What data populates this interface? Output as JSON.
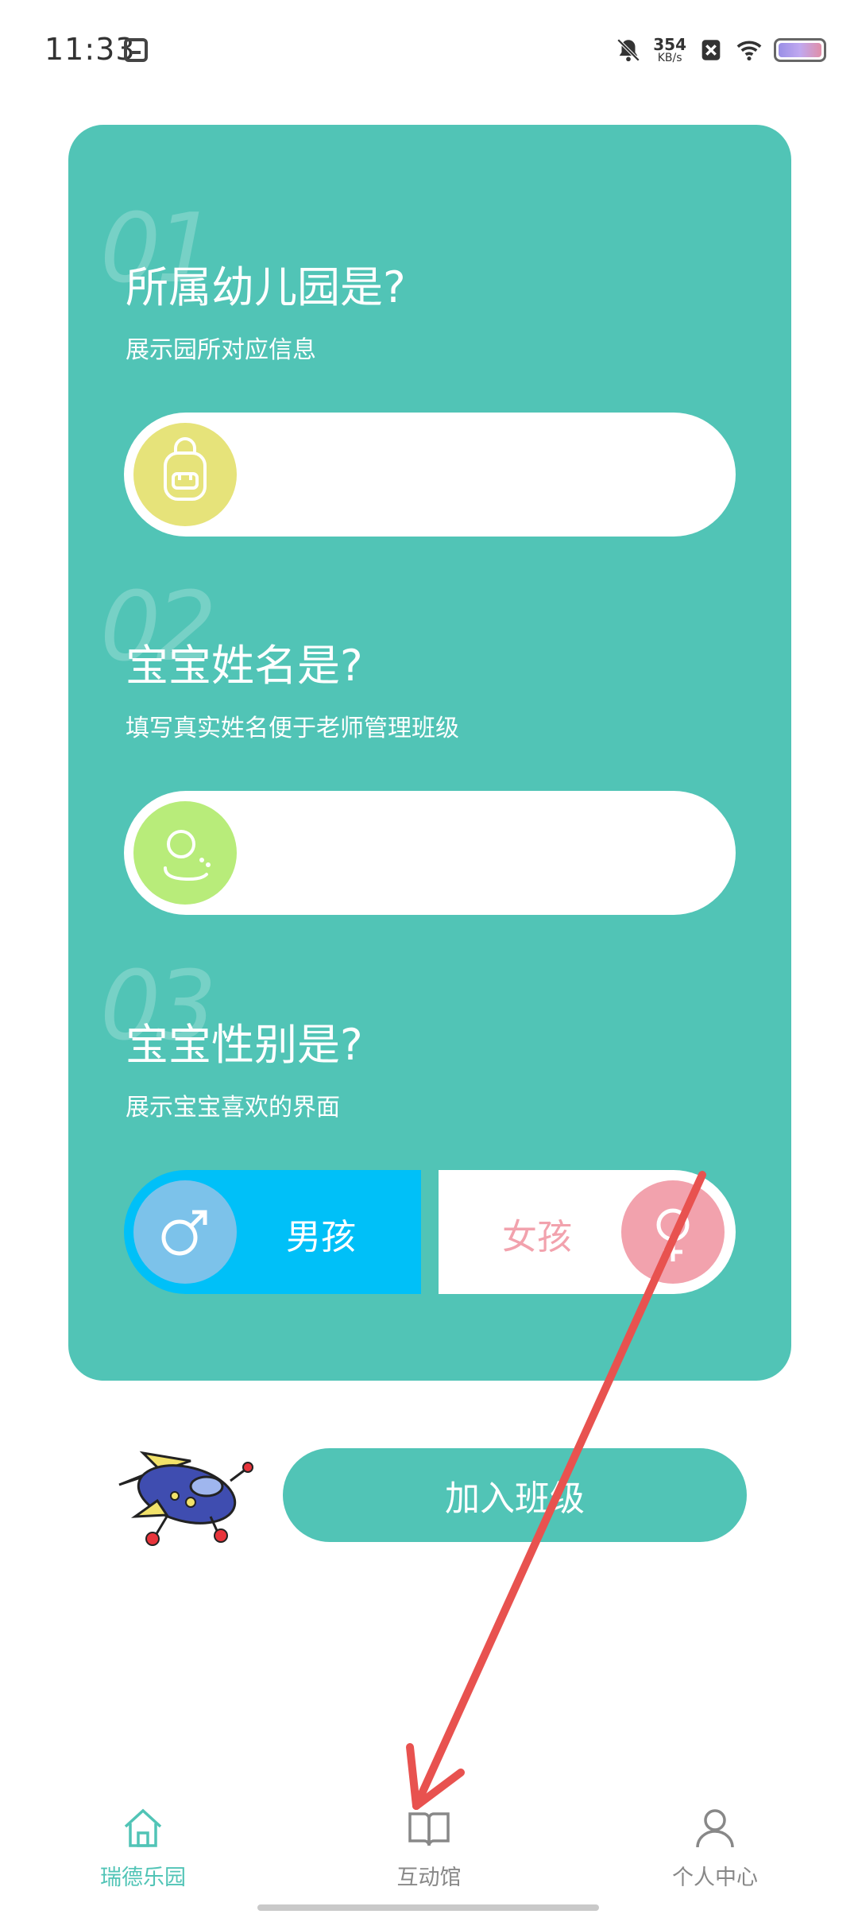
{
  "status_bar": {
    "time": "11:33",
    "speed_value": "354",
    "speed_unit": "KB/s"
  },
  "sections": [
    {
      "number": "01",
      "title": "所属幼儿园是?",
      "subtitle": "展示园所对应信息",
      "icon": "backpack-icon",
      "icon_color": "#e6e37a"
    },
    {
      "number": "02",
      "title": "宝宝姓名是?",
      "subtitle": "填写真实姓名便于老师管理班级",
      "icon": "baby-face-icon",
      "icon_color": "#b8ec7a"
    },
    {
      "number": "03",
      "title": "宝宝性别是?",
      "subtitle": "展示宝宝喜欢的界面"
    }
  ],
  "gender": {
    "boy_label": "男孩",
    "girl_label": "女孩",
    "boy_color": "#00c0f8",
    "boy_circle_color": "#7cc2ea",
    "girl_color": "#f2a2ad",
    "selected": "男孩"
  },
  "join_button_label": "加入班级",
  "nav": {
    "items": [
      {
        "label": "瑞德乐园",
        "icon": "home-icon",
        "active": true
      },
      {
        "label": "互动馆",
        "icon": "book-icon",
        "active": false
      },
      {
        "label": "个人中心",
        "icon": "person-icon",
        "active": false
      }
    ],
    "active_color": "#51c4b6",
    "inactive_color": "#888888"
  },
  "colors": {
    "card": "#51c4b6",
    "annotation_arrow": "#e8524f"
  }
}
